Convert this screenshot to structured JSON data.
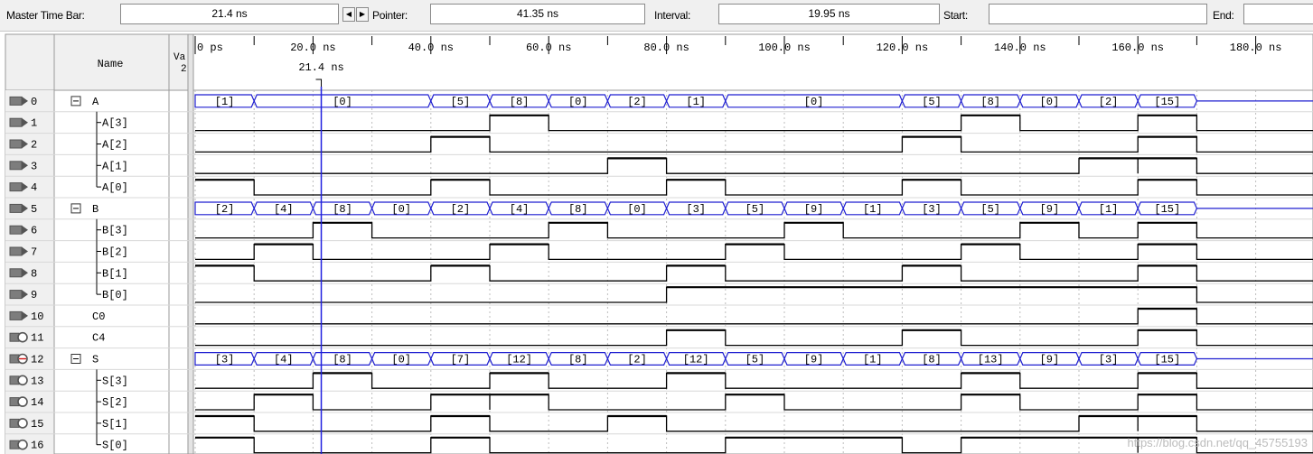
{
  "toolbar": {
    "master_time_bar_label": "Master Time Bar:",
    "master_time_bar_value": "21.4 ns",
    "pointer_label": "Pointer:",
    "pointer_value": "41.35 ns",
    "interval_label": "Interval:",
    "interval_value": "19.95 ns",
    "start_label": "Start:",
    "start_value": "",
    "end_label": "End:",
    "end_value": ""
  },
  "header": {
    "name_label": "Name",
    "value_label_top": "Va",
    "value_label_bottom": "2",
    "cursor_label": "21.4 ns"
  },
  "time_axis": {
    "unit": "ns",
    "start": 0,
    "end": 190,
    "major_step": 20,
    "minor_step": 10,
    "labels": [
      "0 ps",
      "20.0 ns",
      "40.0 ns",
      "60.0 ns",
      "80.0 ns",
      "100.0 ns",
      "120.0 ns",
      "140.0 ns",
      "160.0 ns",
      "180.0 ns"
    ]
  },
  "master_time_bar_ns": 21.4,
  "colors": {
    "bus_line": "#1f1fd0",
    "cursor": "#2020e0",
    "wave": "#000000",
    "grid": "#bdbdbd",
    "toolbar_bg": "#f0f0f0",
    "header_bg": "#f0f0f0"
  },
  "signals": [
    {
      "index": "0",
      "name": "A",
      "kind": "bus",
      "io": "input",
      "group": true,
      "segments": [
        [
          0,
          10,
          "[1]"
        ],
        [
          10,
          40,
          "[0]"
        ],
        [
          40,
          50,
          "[5]"
        ],
        [
          50,
          60,
          "[8]"
        ],
        [
          60,
          70,
          "[0]"
        ],
        [
          70,
          80,
          "[2]"
        ],
        [
          80,
          90,
          "[1]"
        ],
        [
          90,
          120,
          "[0]"
        ],
        [
          120,
          130,
          "[5]"
        ],
        [
          130,
          140,
          "[8]"
        ],
        [
          140,
          150,
          "[0]"
        ],
        [
          150,
          160,
          "[2]"
        ],
        [
          160,
          170,
          "[15]"
        ]
      ]
    },
    {
      "index": "1",
      "name": "A[3]",
      "kind": "bit",
      "io": "input",
      "prefix": "mid",
      "highs": [
        [
          50,
          60
        ],
        [
          130,
          140
        ],
        [
          160,
          170
        ]
      ]
    },
    {
      "index": "2",
      "name": "A[2]",
      "kind": "bit",
      "io": "input",
      "prefix": "mid",
      "highs": [
        [
          40,
          50
        ],
        [
          120,
          130
        ],
        [
          160,
          170
        ]
      ]
    },
    {
      "index": "3",
      "name": "A[1]",
      "kind": "bit",
      "io": "input",
      "prefix": "mid",
      "highs": [
        [
          70,
          80
        ],
        [
          150,
          160
        ],
        [
          160,
          170
        ]
      ]
    },
    {
      "index": "4",
      "name": "A[0]",
      "kind": "bit",
      "io": "input",
      "prefix": "end",
      "highs": [
        [
          0,
          10
        ],
        [
          40,
          50
        ],
        [
          80,
          90
        ],
        [
          120,
          130
        ],
        [
          160,
          170
        ]
      ]
    },
    {
      "index": "5",
      "name": "B",
      "kind": "bus",
      "io": "input",
      "group": true,
      "segments": [
        [
          0,
          10,
          "[2]"
        ],
        [
          10,
          20,
          "[4]"
        ],
        [
          20,
          30,
          "[8]"
        ],
        [
          30,
          40,
          "[0]"
        ],
        [
          40,
          50,
          "[2]"
        ],
        [
          50,
          60,
          "[4]"
        ],
        [
          60,
          70,
          "[8]"
        ],
        [
          70,
          80,
          "[0]"
        ],
        [
          80,
          90,
          "[3]"
        ],
        [
          90,
          100,
          "[5]"
        ],
        [
          100,
          110,
          "[9]"
        ],
        [
          110,
          120,
          "[1]"
        ],
        [
          120,
          130,
          "[3]"
        ],
        [
          130,
          140,
          "[5]"
        ],
        [
          140,
          150,
          "[9]"
        ],
        [
          150,
          160,
          "[1]"
        ],
        [
          160,
          170,
          "[15]"
        ]
      ]
    },
    {
      "index": "6",
      "name": "B[3]",
      "kind": "bit",
      "io": "input",
      "prefix": "mid",
      "highs": [
        [
          20,
          30
        ],
        [
          60,
          70
        ],
        [
          100,
          110
        ],
        [
          140,
          150
        ],
        [
          160,
          170
        ]
      ]
    },
    {
      "index": "7",
      "name": "B[2]",
      "kind": "bit",
      "io": "input",
      "prefix": "mid",
      "highs": [
        [
          10,
          20
        ],
        [
          50,
          60
        ],
        [
          90,
          100
        ],
        [
          130,
          140
        ],
        [
          160,
          170
        ]
      ]
    },
    {
      "index": "8",
      "name": "B[1]",
      "kind": "bit",
      "io": "input",
      "prefix": "mid",
      "highs": [
        [
          0,
          10
        ],
        [
          40,
          50
        ],
        [
          80,
          90
        ],
        [
          120,
          130
        ],
        [
          160,
          170
        ]
      ]
    },
    {
      "index": "9",
      "name": "B[0]",
      "kind": "bit",
      "io": "input",
      "prefix": "end",
      "highs": [
        [
          80,
          170
        ]
      ]
    },
    {
      "index": "10",
      "name": "C0",
      "kind": "bit",
      "io": "input",
      "prefix": "none",
      "highs": [
        [
          160,
          170
        ]
      ]
    },
    {
      "index": "11",
      "name": "C4",
      "kind": "bit",
      "io": "output",
      "prefix": "none",
      "highs": [
        [
          80,
          90
        ],
        [
          120,
          130
        ],
        [
          160,
          170
        ]
      ]
    },
    {
      "index": "12",
      "name": "S",
      "kind": "bus",
      "io": "output",
      "group": true,
      "segments": [
        [
          0,
          10,
          "[3]"
        ],
        [
          10,
          20,
          "[4]"
        ],
        [
          20,
          30,
          "[8]"
        ],
        [
          30,
          40,
          "[0]"
        ],
        [
          40,
          50,
          "[7]"
        ],
        [
          50,
          60,
          "[12]"
        ],
        [
          60,
          70,
          "[8]"
        ],
        [
          70,
          80,
          "[2]"
        ],
        [
          80,
          90,
          "[12]"
        ],
        [
          90,
          100,
          "[5]"
        ],
        [
          100,
          110,
          "[9]"
        ],
        [
          110,
          120,
          "[1]"
        ],
        [
          120,
          130,
          "[8]"
        ],
        [
          130,
          140,
          "[13]"
        ],
        [
          140,
          150,
          "[9]"
        ],
        [
          150,
          160,
          "[3]"
        ],
        [
          160,
          170,
          "[15]"
        ]
      ]
    },
    {
      "index": "13",
      "name": "S[3]",
      "kind": "bit",
      "io": "output",
      "prefix": "mid",
      "highs": [
        [
          20,
          30
        ],
        [
          50,
          60
        ],
        [
          80,
          90
        ],
        [
          130,
          140
        ],
        [
          160,
          170
        ]
      ]
    },
    {
      "index": "14",
      "name": "S[2]",
      "kind": "bit",
      "io": "output",
      "prefix": "mid",
      "highs": [
        [
          10,
          20
        ],
        [
          40,
          50
        ],
        [
          50,
          60
        ],
        [
          90,
          100
        ],
        [
          130,
          140
        ],
        [
          160,
          170
        ]
      ]
    },
    {
      "index": "15",
      "name": "S[1]",
      "kind": "bit",
      "io": "output",
      "prefix": "mid",
      "highs": [
        [
          0,
          10
        ],
        [
          40,
          50
        ],
        [
          70,
          80
        ],
        [
          150,
          160
        ],
        [
          160,
          170
        ]
      ]
    },
    {
      "index": "16",
      "name": "S[0]",
      "kind": "bit",
      "io": "output",
      "prefix": "end",
      "highs": [
        [
          0,
          10
        ],
        [
          40,
          50
        ],
        [
          90,
          120
        ],
        [
          130,
          160
        ],
        [
          160,
          170
        ]
      ]
    }
  ],
  "watermark": "https://blog.csdn.net/qq_45755193"
}
